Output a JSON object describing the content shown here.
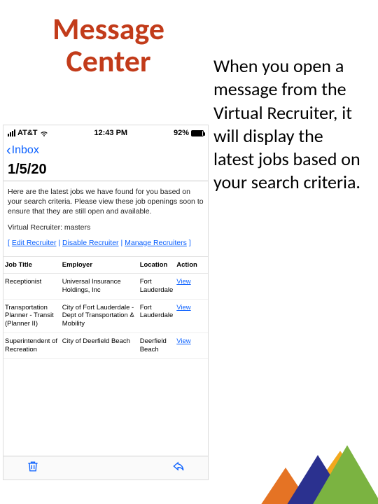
{
  "title_line1": "Message",
  "title_line2": "Center",
  "description": "When you open a message from the Virtual Recruiter, it will display the latest jobs based on your search criteria.",
  "phone": {
    "status": {
      "carrier": "AT&T",
      "time": "12:43 PM",
      "battery_pct": "92%"
    },
    "back_label": "Inbox",
    "date": "1/5/20",
    "intro": "Here are the latest jobs we have found for you based on your search criteria. Please view these job openings soon to ensure that they are still open and available.",
    "vr_label": "Virtual Recruiter: masters",
    "links": {
      "open": "[ ",
      "edit": "Edit Recruiter",
      "sep": " | ",
      "disable": "Disable Recruiter",
      "manage": "Manage Recruiters",
      "close": " ]"
    },
    "columns": {
      "title": "Job Title",
      "employer": "Employer",
      "location": "Location",
      "action": "Action"
    },
    "view_label": "View",
    "rows": [
      {
        "title": "Receptionist",
        "employer": "Universal Insurance Holdings, Inc",
        "location": "Fort Lauderdale"
      },
      {
        "title": "Transportation Planner - Transit (Planner II)",
        "employer": "City of Fort Lauderdale - Dept of Transportation & Mobility",
        "location": "Fort Lauderdale"
      },
      {
        "title": "Superintendent of Recreation",
        "employer": "City of Deerfield Beach",
        "location": "Deerfield Beach"
      }
    ]
  }
}
